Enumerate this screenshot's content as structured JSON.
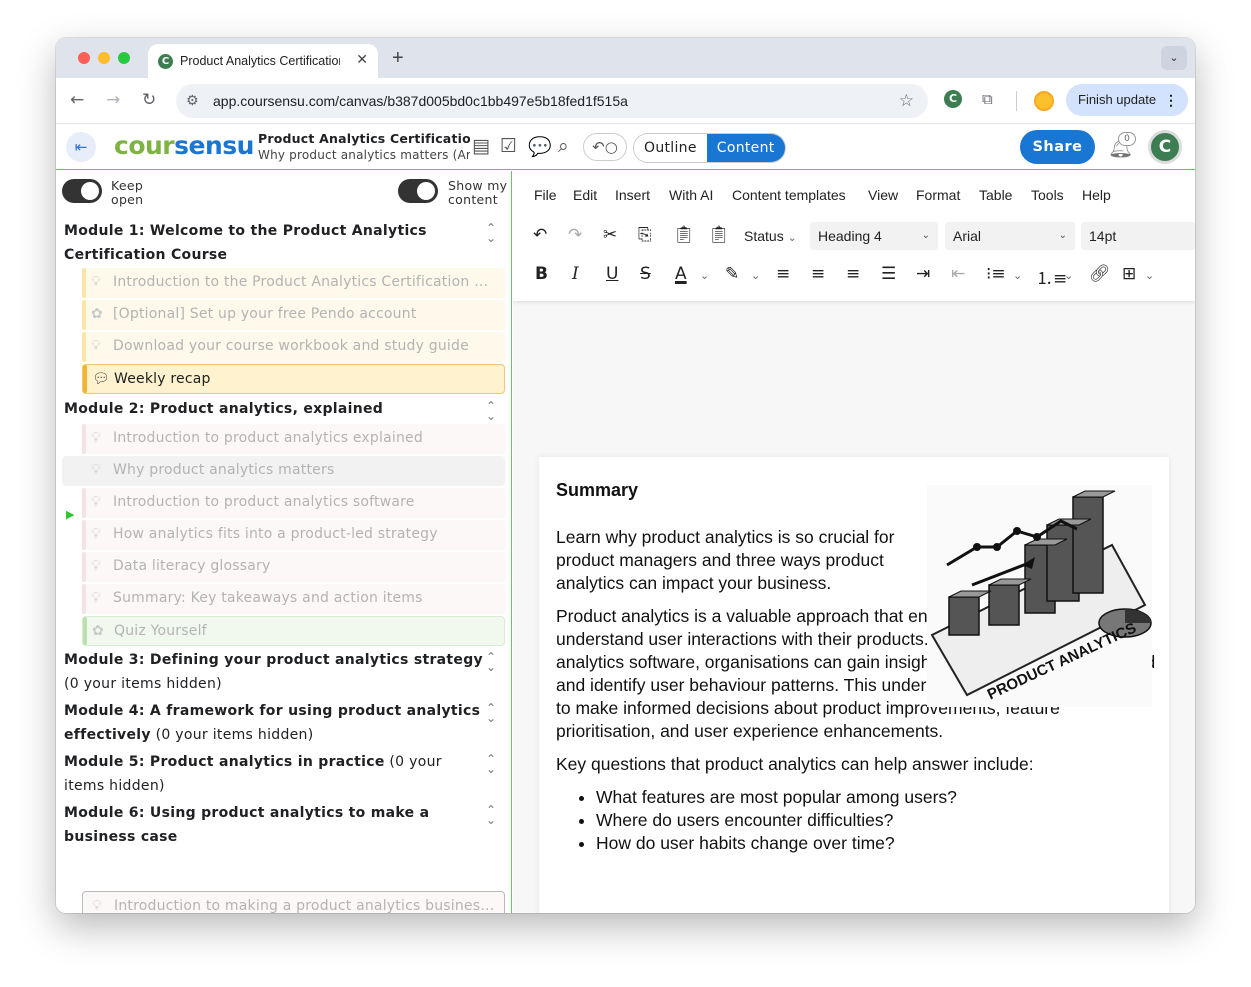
{
  "browser": {
    "tab_title": "Product Analytics Certification",
    "tab_favicon_letter": "C",
    "new_tab_symbol": "+",
    "url": "app.coursensu.com/canvas/b387d005bd0c1bb497e5b18fed1f515a",
    "finish_update_label": "Finish update"
  },
  "app": {
    "logo_a": "cour",
    "logo_b": "sensu",
    "course_title": "Product Analytics Certification Course",
    "course_subtitle": "Why product analytics matters (Article)",
    "outline_label": "Outline",
    "content_label": "Content",
    "share_label": "Share",
    "notification_count": "0",
    "user_initial": "C"
  },
  "sidebar": {
    "keep_open_label": "Keep open",
    "show_content_label": "Show my content",
    "modules": [
      {
        "title": "Module 1: Welcome to the Product Analytics Certification Course",
        "note": ""
      },
      {
        "title": "Module 2: Product analytics, explained",
        "note": ""
      },
      {
        "title": "Module 3: Defining your product analytics strategy",
        "note": "(0 your items hidden)"
      },
      {
        "title": "Module 4: A framework for using product analytics effectively",
        "note": "(0 your items hidden)"
      },
      {
        "title": "Module 5: Product analytics in practice",
        "note": "(0 your items hidden)"
      },
      {
        "title": "Module 6: Using product analytics to make a business case",
        "note": ""
      }
    ],
    "items": [
      "Introduction to the Product Analytics Certification Course",
      "[Optional] Set up your free Pendo account",
      "Download your course workbook and study guide",
      "Weekly recap",
      "Introduction to product analytics explained",
      "Why product analytics matters",
      "Introduction to product analytics software",
      "How analytics fits into a product-led strategy",
      "Data literacy glossary",
      "Summary: Key takeaways and action items",
      "Quiz Yourself",
      "Introduction to making a product analytics business case"
    ]
  },
  "editor": {
    "menus": [
      "File",
      "Edit",
      "Insert",
      "With AI",
      "Content templates",
      "View",
      "Format",
      "Table",
      "Tools",
      "Help"
    ],
    "status_label": "Status",
    "block_format": "Heading 4",
    "font_family": "Arial",
    "font_size": "14pt"
  },
  "document": {
    "heading": "Summary",
    "paragraph1": "Learn why product analytics is so crucial for product managers and three ways product analytics can impact your business.",
    "paragraph2": "Product analytics is a valuable approach that enables businesses to understand user interactions with their products. By leveraging product analytics software, organisations can gain insights into how features are used and identify user behaviour patterns. This understanding allows businesses to make informed decisions about product improvements, feature prioritisation, and user experience enhancements.",
    "paragraph3": "Key questions that product analytics can help answer include:",
    "bullets": [
      "What features are most popular among users?",
      "Where do users encounter difficulties?",
      "How do user habits change over time?"
    ],
    "image_text": "PRODUCT ANALYTICS"
  }
}
